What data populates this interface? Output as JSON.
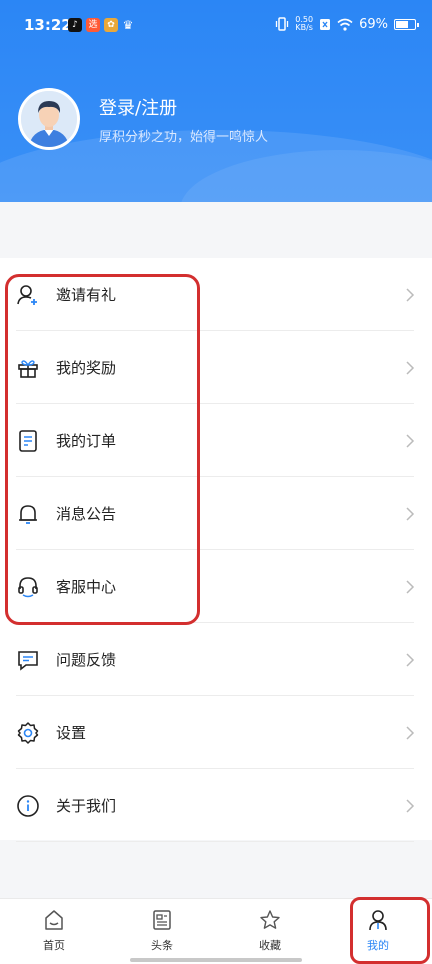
{
  "status": {
    "time": "13:22",
    "net_speed_value": "0.50",
    "net_speed_unit": "KB/s",
    "battery": "69%"
  },
  "profile": {
    "title": "登录/注册",
    "subtitle": "厚积分秒之功，始得一鸣惊人"
  },
  "menu": [
    {
      "label": "邀请有礼",
      "icon": "add-user-icon"
    },
    {
      "label": "我的奖励",
      "icon": "gift-icon"
    },
    {
      "label": "我的订单",
      "icon": "order-icon"
    },
    {
      "label": "消息公告",
      "icon": "bell-icon"
    },
    {
      "label": "客服中心",
      "icon": "headset-icon"
    },
    {
      "label": "问题反馈",
      "icon": "message-icon"
    },
    {
      "label": "设置",
      "icon": "gear-icon"
    },
    {
      "label": "关于我们",
      "icon": "info-icon"
    }
  ],
  "tabs": [
    {
      "label": "首页",
      "icon": "home-icon",
      "active": false
    },
    {
      "label": "头条",
      "icon": "news-icon",
      "active": false
    },
    {
      "label": "收藏",
      "icon": "star-icon",
      "active": false
    },
    {
      "label": "我的",
      "icon": "profile-icon",
      "active": true
    }
  ],
  "colors": {
    "accent": "#2b86f5",
    "highlight": "#d32f2f"
  }
}
